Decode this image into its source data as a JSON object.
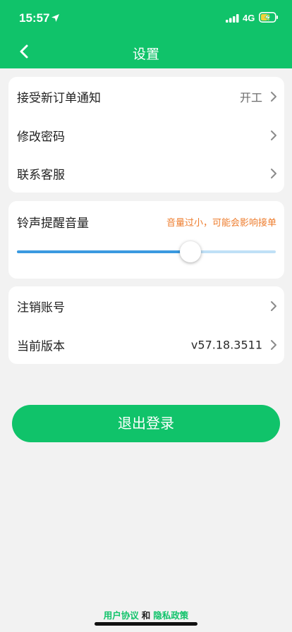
{
  "status_bar": {
    "time": "15:57",
    "network": "4G",
    "icons": [
      "location-arrow-icon",
      "signal-bars-icon",
      "battery-charging-icon"
    ]
  },
  "header": {
    "title": "设置",
    "back_icon": "chevron-left-icon"
  },
  "group1": {
    "rows": [
      {
        "label": "接受新订单通知",
        "value": "开工"
      },
      {
        "label": "修改密码",
        "value": ""
      },
      {
        "label": "联系客服",
        "value": ""
      }
    ]
  },
  "volume": {
    "label": "铃声提醒音量",
    "warning": "音量过小，可能会影响接单",
    "level": 0.67
  },
  "group2": {
    "rows": [
      {
        "label": "注销账号",
        "value": ""
      },
      {
        "label": "当前版本",
        "value": "v57.18.3511"
      }
    ]
  },
  "logout": {
    "label": "退出登录"
  },
  "footer": {
    "user_agreement": "用户协议",
    "and": "和",
    "privacy_policy": "隐私政策"
  },
  "colors": {
    "brand": "#10c36a",
    "warning": "#ee7d2e",
    "slider_fill": "#3a9ae0",
    "slider_track": "#bfe0f6"
  }
}
